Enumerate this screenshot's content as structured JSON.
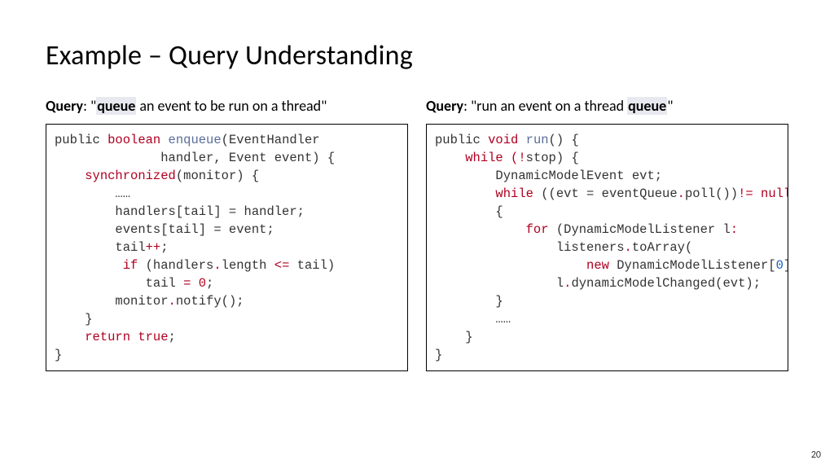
{
  "title": "Example – Query Understanding",
  "slide_number": "20",
  "left": {
    "query_label": "Query",
    "query_before": ": \"",
    "query_highlight": "queue",
    "query_after": " an event to be run on a thread\"",
    "code": {
      "l1a": "public ",
      "l1b": "boolean ",
      "l1c": "enqueue",
      "l1d": "(EventHandler",
      "l2": "              handler, Event event) {",
      "l3a": "    ",
      "l3b": "synchronized",
      "l3c": "(monitor) {",
      "l4": "        ……",
      "l5": "        handlers[tail] = handler;",
      "l6": "        events[tail] = event;",
      "l7a": "        tail",
      "l7b": "++",
      "l7c": ";",
      "l8a": "         ",
      "l8b": "if ",
      "l8c": "(handlers",
      "l8d": ".",
      "l8e": "length ",
      "l8f": "<=",
      "l8g": " tail)",
      "l9a": "            tail ",
      "l9b": "= 0",
      "l9c": ";",
      "l10a": "        monitor",
      "l10b": ".",
      "l10c": "notify();",
      "l11": "    }",
      "l12a": "    ",
      "l12b": "return true",
      "l12c": ";",
      "l13": "}"
    }
  },
  "right": {
    "query_label": "Query",
    "query_before": ": \"run an event on a thread ",
    "query_highlight": "queue",
    "query_after": "\"",
    "code": {
      "l1a": "public ",
      "l1b": "void ",
      "l1c": "run",
      "l1d": "() {",
      "l2a": "    ",
      "l2b": "while ",
      "l2c": "(!",
      "l2d": "stop) {",
      "l3": "        DynamicModelEvent evt;",
      "l4a": "        ",
      "l4b": "while ",
      "l4c": "((evt = eventQueue",
      "l4d": ".",
      "l4e": "poll())",
      "l4f": "!= ",
      "l4g": "null",
      "l4h": ")",
      "l5": "        {",
      "l6a": "            ",
      "l6b": "for ",
      "l6c": "(DynamicModelListener l",
      "l6d": ":",
      "l7a": "                listeners",
      "l7b": ".",
      "l7c": "toArray(",
      "l8a": "                    ",
      "l8b": "new ",
      "l8c": "DynamicModelListener[",
      "l8d": "0",
      "l8e": "]))",
      "l9a": "                l",
      "l9b": ".",
      "l9c": "dynamicModelChanged(evt);",
      "l10": "        }",
      "l11": "        ……",
      "l12": "    }",
      "l13": "}"
    }
  }
}
